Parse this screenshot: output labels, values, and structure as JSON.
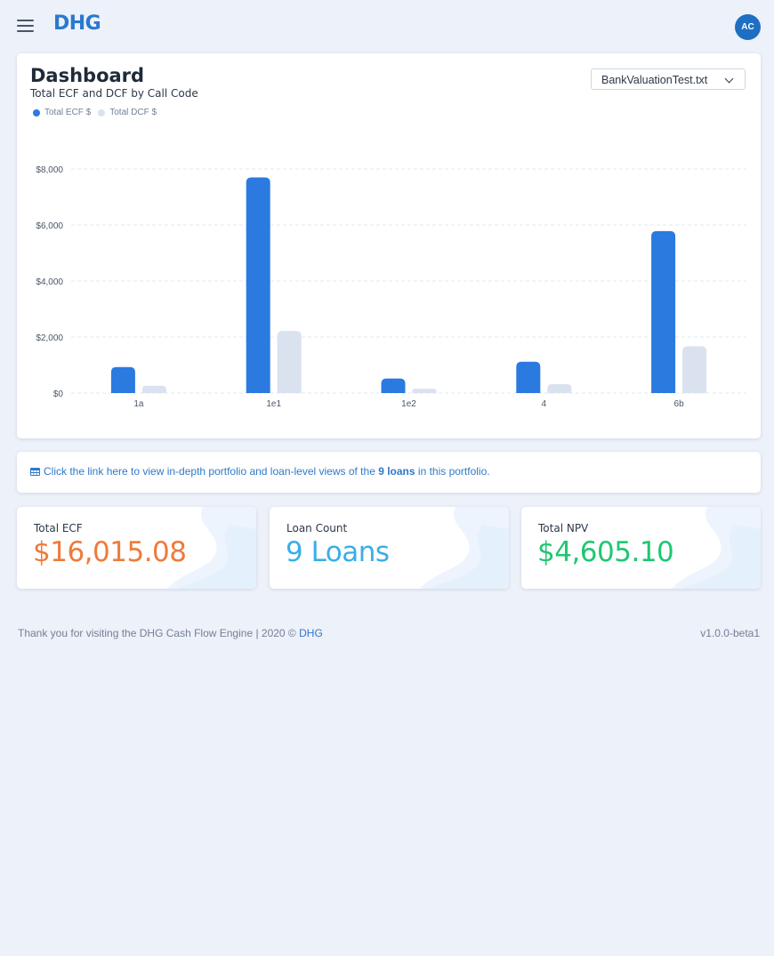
{
  "header": {
    "logo": "DHG",
    "avatar_initials": "AC",
    "menu_icon": "hamburger-icon"
  },
  "dashboard": {
    "title": "Dashboard",
    "subtitle": "Total ECF and DCF by Call Code",
    "file_select_value": "BankValuationTest.txt",
    "legend": [
      {
        "label": "Total ECF $",
        "color": "#2b7ae0"
      },
      {
        "label": "Total DCF $",
        "color": "#d9e2ee"
      }
    ]
  },
  "chart_data": {
    "type": "bar",
    "categories": [
      "1a",
      "1e1",
      "1e2",
      "4",
      "6b"
    ],
    "series": [
      {
        "name": "Total ECF $",
        "color": "#2b7ae0",
        "values": [
          930,
          7700,
          520,
          1120,
          5780
        ]
      },
      {
        "name": "Total DCF $",
        "color": "#d9e2ee",
        "values": [
          260,
          2220,
          150,
          320,
          1670
        ]
      }
    ],
    "y_ticks": [
      "$0",
      "$2,000",
      "$4,000",
      "$6,000",
      "$8,000"
    ],
    "ylim": [
      0,
      8000
    ],
    "grid": true,
    "legend_position": "top-left"
  },
  "info": {
    "text_before": "Click the link here to view in-depth portfolio and loan-level views of the ",
    "bold": "9 loans",
    "text_after": " in this portfolio."
  },
  "stats": [
    {
      "label": "Total ECF",
      "value": "$16,015.08",
      "color": "#ee7b3a"
    },
    {
      "label": "Loan Count",
      "value": "9 Loans",
      "color": "#3aaee8"
    },
    {
      "label": "Total NPV",
      "value": "$4,605.10",
      "color": "#1fc772"
    }
  ],
  "footer": {
    "text": "Thank you for visiting the DHG Cash Flow Engine | 2020 © ",
    "link": "DHG",
    "version": "v1.0.0-beta1"
  }
}
